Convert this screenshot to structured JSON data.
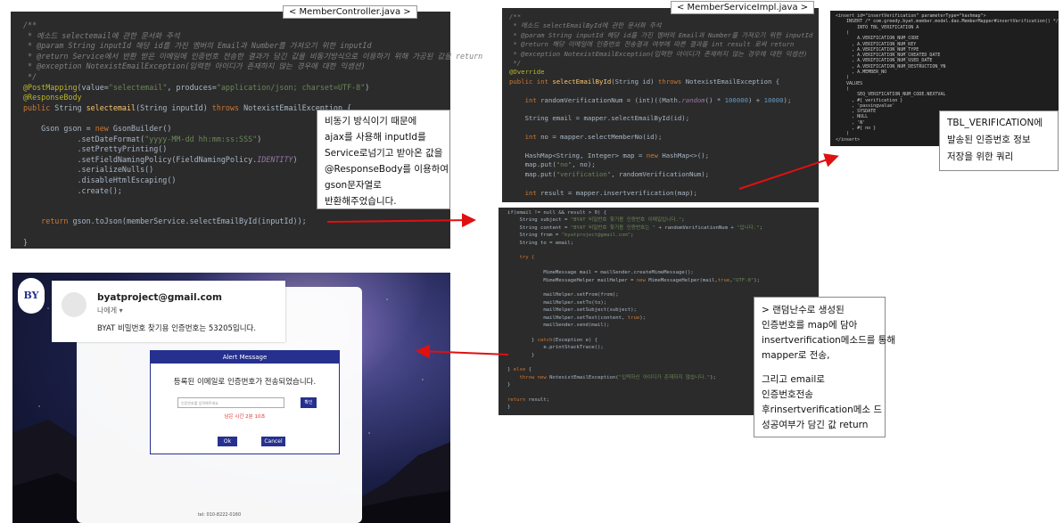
{
  "controller": {
    "tab": "< MemberController.java >",
    "lines": [
      [
        {
          "t": "/**",
          "c": "cm"
        }
      ],
      [
        {
          "t": " * 메소드 ",
          "c": "cm"
        },
        {
          "t": "selectemail",
          "c": "cm"
        },
        {
          "t": "에 관한 문서화 주석",
          "c": "cm"
        }
      ],
      [
        {
          "t": " * @param String inputId 해당 id를 가진 멤버의 Email과 Number를 가져오기 위한 inputId",
          "c": "cm"
        }
      ],
      [
        {
          "t": " * @return Service에서 반환 받은 이메일에 인증번호 전송한 결과가 담긴 값을 비동기방식으로 이용하기 위해 가공된 값을 return",
          "c": "cm"
        }
      ],
      [
        {
          "t": " * @exception NotexistEmailException(입력한 아이디가 존재하지 않는 경우에 대한 익셉션)",
          "c": "cm"
        }
      ],
      [
        {
          "t": " */",
          "c": "cm"
        }
      ],
      [
        {
          "t": "@PostMapping",
          "c": "ann"
        },
        {
          "t": "(value=",
          "c": ""
        },
        {
          "t": "\"selectemail\"",
          "c": "str"
        },
        {
          "t": ", produces=",
          "c": ""
        },
        {
          "t": "\"application/json; charset=UTF-8\"",
          "c": "str"
        },
        {
          "t": ")",
          "c": ""
        }
      ],
      [
        {
          "t": "@ResponseBody",
          "c": "ann"
        }
      ],
      [
        {
          "t": "public ",
          "c": "kw"
        },
        {
          "t": "String ",
          "c": ""
        },
        {
          "t": "selectemail",
          "c": "fn"
        },
        {
          "t": "(String inputId) ",
          "c": ""
        },
        {
          "t": "throws ",
          "c": "kw"
        },
        {
          "t": "NotexistEmailException {",
          "c": ""
        }
      ],
      [
        {
          "t": "",
          "c": ""
        }
      ],
      [
        {
          "t": "    Gson gson = ",
          "c": ""
        },
        {
          "t": "new ",
          "c": "kw"
        },
        {
          "t": "GsonBuilder()",
          "c": ""
        }
      ],
      [
        {
          "t": "            .setDateFormat(",
          "c": ""
        },
        {
          "t": "\"yyyy-MM-dd hh:mm:ss:SSS\"",
          "c": "str"
        },
        {
          "t": ")",
          "c": ""
        }
      ],
      [
        {
          "t": "            .setPrettyPrinting()",
          "c": ""
        }
      ],
      [
        {
          "t": "            .setFieldNamingPolicy(FieldNamingPolicy.",
          "c": ""
        },
        {
          "t": "IDENTITY",
          "c": "fld"
        },
        {
          "t": ")",
          "c": ""
        }
      ],
      [
        {
          "t": "            .serializeNulls()",
          "c": ""
        }
      ],
      [
        {
          "t": "            .disableHtmlEscaping()",
          "c": ""
        }
      ],
      [
        {
          "t": "            .create();",
          "c": ""
        }
      ],
      [
        {
          "t": "",
          "c": ""
        }
      ],
      [
        {
          "t": "",
          "c": ""
        }
      ],
      [
        {
          "t": "    return ",
          "c": "kw"
        },
        {
          "t": "gson.toJson(memberService.selectEmailById(inputId));",
          "c": ""
        }
      ],
      [
        {
          "t": "",
          "c": ""
        }
      ],
      [
        {
          "t": "}",
          "c": ""
        }
      ]
    ]
  },
  "note_controller": [
    "비동기 방식이기 때문에",
    "ajax를 사용해 inputId를",
    "Service로넘기고 받아온 값을",
    "@ResponseBody를 이용하여",
    "gson문자열로",
    "반환해주었습니다."
  ],
  "service": {
    "tab": "< MemberServiceImpl.java >",
    "lines": [
      [
        {
          "t": "/**",
          "c": "cm"
        }
      ],
      [
        {
          "t": " * 메소드 selectEmailById에 관한 문서화 주석",
          "c": "cm"
        }
      ],
      [
        {
          "t": " * @param String inputId 해당 id를 가진 멤버의 Email과 Number를 가져오기 위한 inputId",
          "c": "cm"
        }
      ],
      [
        {
          "t": " * @return 해당 이메일에 인증번호 전송결과 여부에 따른 결과를 int result 로써 return",
          "c": "cm"
        }
      ],
      [
        {
          "t": " * @exception NotexistEmailException(입력한 아이디가 존재하지 않는 경우에 대한 익셉션)",
          "c": "cm"
        }
      ],
      [
        {
          "t": " */",
          "c": "cm"
        }
      ],
      [
        {
          "t": "@Override",
          "c": "ann"
        }
      ],
      [
        {
          "t": "public int ",
          "c": "kw"
        },
        {
          "t": "selectEmailById",
          "c": "fn"
        },
        {
          "t": "(String id) ",
          "c": ""
        },
        {
          "t": "throws ",
          "c": "kw"
        },
        {
          "t": "NotexistEmailException {",
          "c": ""
        }
      ],
      [
        {
          "t": "",
          "c": ""
        }
      ],
      [
        {
          "t": "    int ",
          "c": "kw"
        },
        {
          "t": "randomVerificationNum = (int)((Math.",
          "c": ""
        },
        {
          "t": "random",
          "c": "fld"
        },
        {
          "t": "() * ",
          "c": ""
        },
        {
          "t": "100000",
          "c": "num"
        },
        {
          "t": ") + ",
          "c": ""
        },
        {
          "t": "10000",
          "c": "num"
        },
        {
          "t": ");",
          "c": ""
        }
      ],
      [
        {
          "t": "",
          "c": ""
        }
      ],
      [
        {
          "t": "    String email = mapper.selectEmailById(id);",
          "c": ""
        }
      ],
      [
        {
          "t": "",
          "c": ""
        }
      ],
      [
        {
          "t": "    int ",
          "c": "kw"
        },
        {
          "t": "no = mapper.selectMemberNo(id);",
          "c": ""
        }
      ],
      [
        {
          "t": "",
          "c": ""
        }
      ],
      [
        {
          "t": "    HashMap<String, Integer> map = ",
          "c": ""
        },
        {
          "t": "new ",
          "c": "kw"
        },
        {
          "t": "HashMap<>();",
          "c": ""
        }
      ],
      [
        {
          "t": "    map.put(",
          "c": ""
        },
        {
          "t": "\"no\"",
          "c": "str"
        },
        {
          "t": ", no);",
          "c": ""
        }
      ],
      [
        {
          "t": "    map.put(",
          "c": ""
        },
        {
          "t": "\"verification\"",
          "c": "str"
        },
        {
          "t": ", randomVerificationNum);",
          "c": ""
        }
      ],
      [
        {
          "t": "",
          "c": ""
        }
      ],
      [
        {
          "t": "    int ",
          "c": "kw"
        },
        {
          "t": "result = mapper.insertverification(map);",
          "c": ""
        }
      ]
    ]
  },
  "service_mail": {
    "lines": [
      [
        {
          "t": "if(email != null && result > 0) {",
          "c": ""
        }
      ],
      [
        {
          "t": "    String subject = ",
          "c": ""
        },
        {
          "t": "\"BYAT 비밀번호 찾기용 인증번호 이메일입니다.\"",
          "c": "str"
        },
        {
          "t": ";",
          "c": ""
        }
      ],
      [
        {
          "t": "    String content = ",
          "c": ""
        },
        {
          "t": "\"BYAT 비밀번호 찾기용 인증번호는 \"",
          "c": "str"
        },
        {
          "t": " + randomVerificationNum + ",
          "c": ""
        },
        {
          "t": "\"입니다.\"",
          "c": "str"
        },
        {
          "t": ";",
          "c": ""
        }
      ],
      [
        {
          "t": "    String from = ",
          "c": ""
        },
        {
          "t": "\"byatproject@gmail.com\"",
          "c": "str"
        },
        {
          "t": ";",
          "c": ""
        }
      ],
      [
        {
          "t": "    String to = email;",
          "c": ""
        }
      ],
      [
        {
          "t": "",
          "c": ""
        }
      ],
      [
        {
          "t": "    try {",
          "c": "kw"
        }
      ],
      [
        {
          "t": "",
          "c": ""
        }
      ],
      [
        {
          "t": "            MimeMessage mail = mailSender.createMimeMessage();",
          "c": ""
        }
      ],
      [
        {
          "t": "            MimeMessageHelper mailHelper = ",
          "c": ""
        },
        {
          "t": "new ",
          "c": "kw"
        },
        {
          "t": "MimeMessageHelper(mail,",
          "c": ""
        },
        {
          "t": "true",
          "c": "kw"
        },
        {
          "t": ",",
          "c": ""
        },
        {
          "t": "\"UTF-8\"",
          "c": "str"
        },
        {
          "t": ");",
          "c": ""
        }
      ],
      [
        {
          "t": "",
          "c": ""
        }
      ],
      [
        {
          "t": "            mailHelper.setFrom(from);",
          "c": ""
        }
      ],
      [
        {
          "t": "            mailHelper.setTo(to);",
          "c": ""
        }
      ],
      [
        {
          "t": "            mailHelper.setSubject(subject);",
          "c": ""
        }
      ],
      [
        {
          "t": "            mailHelper.setText(content, ",
          "c": ""
        },
        {
          "t": "true",
          "c": "kw"
        },
        {
          "t": ");",
          "c": ""
        }
      ],
      [
        {
          "t": "            mailSender.send(mail);",
          "c": ""
        }
      ],
      [
        {
          "t": "",
          "c": ""
        }
      ],
      [
        {
          "t": "        } ",
          "c": ""
        },
        {
          "t": "catch",
          "c": "kw"
        },
        {
          "t": "(Exception e) {",
          "c": ""
        }
      ],
      [
        {
          "t": "            e.printStackTrace();",
          "c": ""
        }
      ],
      [
        {
          "t": "        }",
          "c": ""
        }
      ],
      [
        {
          "t": "",
          "c": ""
        }
      ],
      [
        {
          "t": "} ",
          "c": ""
        },
        {
          "t": "else ",
          "c": "kw"
        },
        {
          "t": "{",
          "c": ""
        }
      ],
      [
        {
          "t": "    throw new ",
          "c": "kw"
        },
        {
          "t": "NotexistEmailException(",
          "c": ""
        },
        {
          "t": "\"입력하신 아이디가 존재하지 않습니다.\"",
          "c": "str"
        },
        {
          "t": ");",
          "c": ""
        }
      ],
      [
        {
          "t": "}",
          "c": ""
        }
      ],
      [
        {
          "t": "",
          "c": ""
        }
      ],
      [
        {
          "t": "return ",
          "c": "kw"
        },
        {
          "t": "result;",
          "c": ""
        }
      ],
      [
        {
          "t": "}",
          "c": ""
        }
      ]
    ]
  },
  "mapper_xml": {
    "lines": [
      "<insert id=\"insertVerification\" parameterType=\"hashmap\">",
      "    INSERT /* com.greedy.byat.member.model.dao.MemberMapper#insertVerification() */",
      "        INTO TBL_VERIFICATION A",
      "    (",
      "        A.VERIFICATION_NUM_CODE",
      "      , A.VERIFICATION_NUM_KEY",
      "      , A.VERIFICATION_NUM_TYPE",
      "      , A.VERIFICATION_NUM_CREATED_DATE",
      "      , A.VERIFICATION_NUM_USED_DATE",
      "      , A.VERIFICATION_NUM_DESTRUCTION_YN",
      "      , A.MEMBER_NO",
      "    )",
      "    VALUES",
      "    (",
      "        SEQ_VERIFICATION_NUM_CODE.NEXTVAL",
      "      , #{ verification }",
      "      , 'passingvalue'",
      "      , SYSDATE",
      "      , NULL",
      "      , 'N'",
      "      , #{ no }",
      "    )",
      "</insert>"
    ]
  },
  "note_mapper": [
    "TBL_VERIFICATION에",
    "발송된 인증번호 정보",
    "저장을 위한 쿼리"
  ],
  "note_mail": [
    "> 랜덤난수로 생성된",
    "인증번호를 map에 담아",
    "insertverification메소드를 통해",
    "mapper로 전송,",
    "",
    "그리고 email로",
    "인증번호전송",
    "후rinsertverification메소 드",
    "성공여부가 담긴 값 return"
  ],
  "email_card": {
    "sender": "byatproject@gmail.com",
    "to": "나에게 ▾",
    "body": "BYAT 비밀번호 찾기용 인증번호는 53205입니다."
  },
  "modal": {
    "title": "Alert Message",
    "message": "등록된 이메일로 인증번호가 전송되었습니다.",
    "input_placeholder": "인증번호를 입력해주세요",
    "confirm_label": "확인",
    "timer": "남은 시간 2분 10초",
    "ok_label": "Ok",
    "cancel_label": "Cancel"
  },
  "login_footer": "tel: 010-8222-0160",
  "logo_text": "BY",
  "colors": {
    "code_bg": "#2b2b2b",
    "keyword": "#cc7832",
    "annotation": "#bbb529",
    "string": "#6a8759",
    "arrow": "#e01010",
    "modal_header": "#26308e"
  }
}
